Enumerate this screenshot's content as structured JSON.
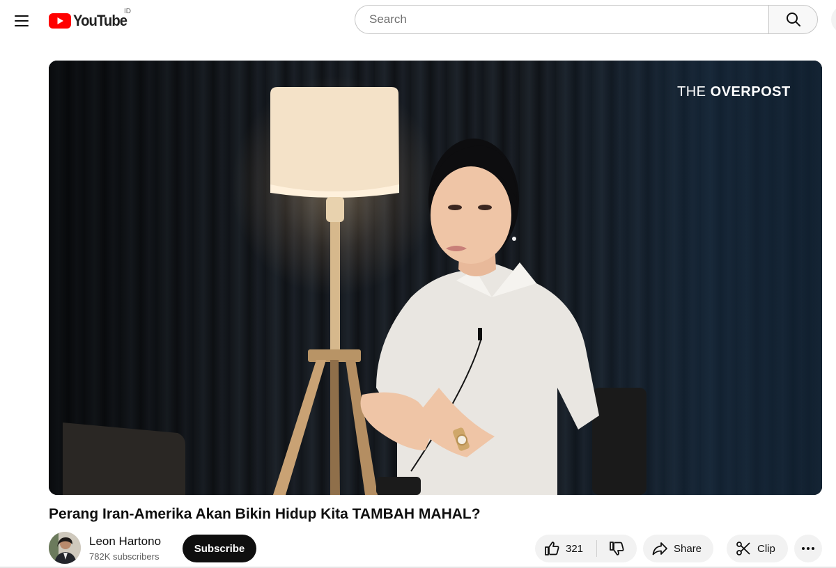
{
  "header": {
    "logo_text": "YouTube",
    "country_code": "ID",
    "search_placeholder": "Search"
  },
  "video": {
    "overlay_logo_thin": "THE ",
    "overlay_logo_bold": "OVERPOST",
    "title": "Perang Iran-Amerika Akan Bikin Hidup Kita TAMBAH MAHAL?"
  },
  "channel": {
    "name": "Leon Hartono",
    "subscribers": "782K subscribers",
    "subscribe_label": "Subscribe"
  },
  "actions": {
    "like_count": "321",
    "share_label": "Share",
    "clip_label": "Clip"
  },
  "colors": {
    "brand_red": "#ff0000",
    "subscribe_bg": "#0f0f0f",
    "pill_bg": "#f2f2f2"
  },
  "icons": [
    "menu-icon",
    "youtube-logo-icon",
    "search-icon",
    "thumbs-up-icon",
    "thumbs-down-icon",
    "share-arrow-icon",
    "scissors-icon",
    "more-horizontal-icon"
  ]
}
